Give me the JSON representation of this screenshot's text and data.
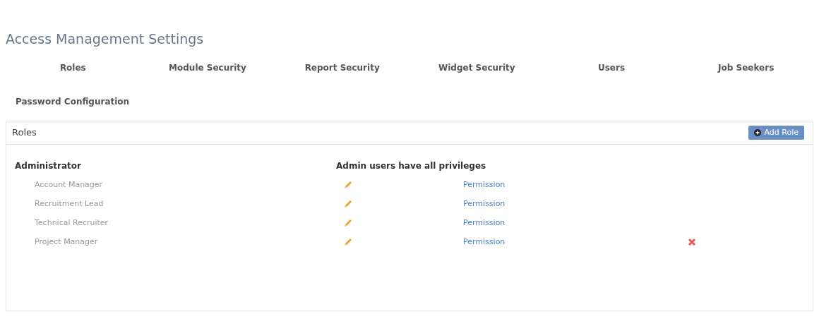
{
  "title": "Access Management Settings",
  "tabs": [
    {
      "label": "Roles"
    },
    {
      "label": "Module Security"
    },
    {
      "label": "Report Security"
    },
    {
      "label": "Widget Security"
    },
    {
      "label": "Users"
    },
    {
      "label": "Job Seekers"
    },
    {
      "label": "Password Configuration"
    }
  ],
  "panel": {
    "title": "Roles",
    "add_button": "Add Role",
    "admin": {
      "name": "Administrator",
      "note": "Admin users have all privileges"
    },
    "roles": [
      {
        "name": "Account Manager",
        "link": "Permission",
        "deletable": false
      },
      {
        "name": "Recruitment Lead",
        "link": "Permission",
        "deletable": false
      },
      {
        "name": "Technical Recruiter",
        "link": "Permission",
        "deletable": false
      },
      {
        "name": "Project Manager",
        "link": "Permission",
        "deletable": true
      }
    ]
  }
}
